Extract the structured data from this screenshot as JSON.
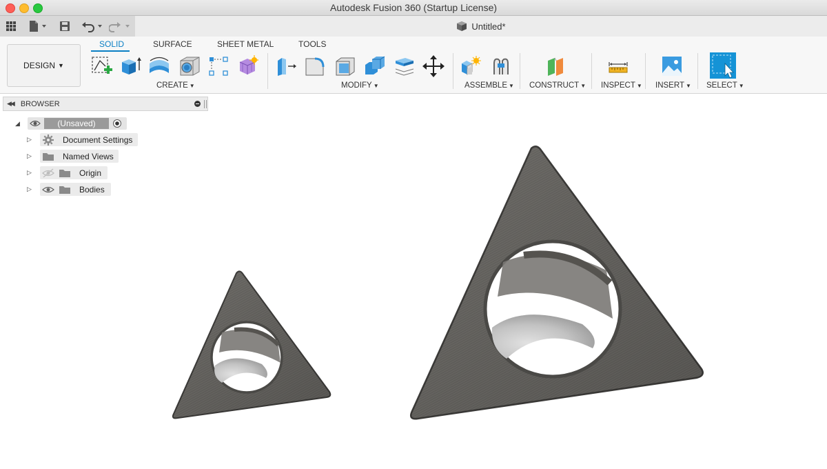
{
  "window": {
    "title": "Autodesk Fusion 360 (Startup License)"
  },
  "document": {
    "tab_title": "Untitled*"
  },
  "workspace": {
    "label": "DESIGN"
  },
  "ribbon": {
    "tabs": [
      "SOLID",
      "SURFACE",
      "SHEET METAL",
      "TOOLS"
    ],
    "active_tab": "SOLID",
    "groups": [
      "CREATE",
      "MODIFY",
      "ASSEMBLE",
      "CONSTRUCT",
      "INSPECT",
      "INSERT",
      "SELECT"
    ]
  },
  "browser": {
    "title": "BROWSER",
    "root": "(Unsaved)",
    "items": [
      {
        "label": "Document Settings",
        "icon": "gear-icon"
      },
      {
        "label": "Named Views",
        "icon": "folder-icon"
      },
      {
        "label": "Origin",
        "icon": "folder-icon",
        "visibility": "hidden"
      },
      {
        "label": "Bodies",
        "icon": "folder-icon",
        "visibility": "visible"
      }
    ]
  },
  "colors": {
    "accent": "#0a7fc4",
    "select_blue": "#1593d6",
    "model_gray": "#6f6d69"
  }
}
